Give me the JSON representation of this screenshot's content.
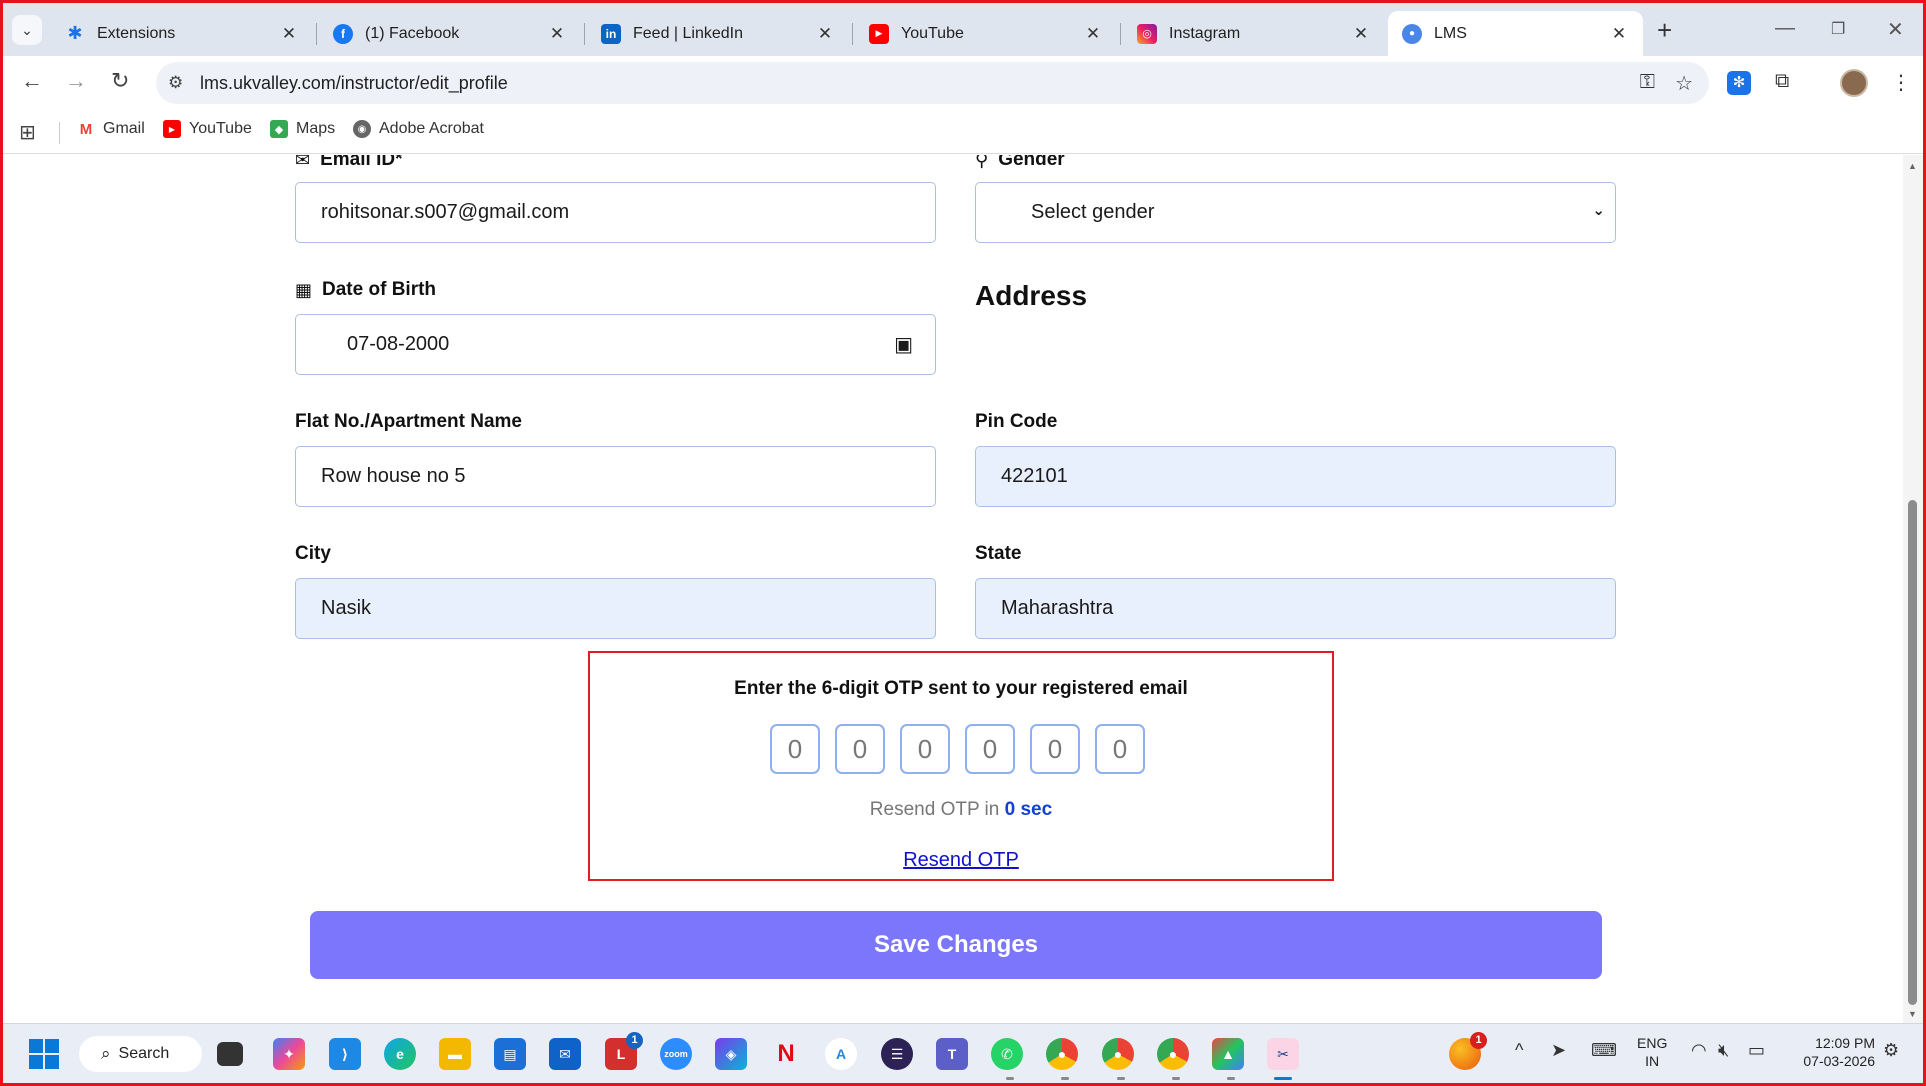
{
  "browser": {
    "tabs": [
      {
        "label": "Extensions",
        "icon": "puzzle-icon",
        "active": false
      },
      {
        "label": "(1) Facebook",
        "icon": "facebook-icon",
        "active": false
      },
      {
        "label": "Feed | LinkedIn",
        "icon": "linkedin-icon",
        "active": false
      },
      {
        "label": "YouTube",
        "icon": "youtube-icon",
        "active": false
      },
      {
        "label": "Instagram",
        "icon": "instagram-icon",
        "active": false
      },
      {
        "label": "LMS",
        "icon": "lms-icon",
        "active": true
      }
    ],
    "url": "lms.ukvalley.com/instructor/edit_profile",
    "bookmarks": [
      {
        "label": "Gmail",
        "icon": "gmail-icon"
      },
      {
        "label": "YouTube",
        "icon": "youtube-icon"
      },
      {
        "label": "Maps",
        "icon": "maps-icon"
      },
      {
        "label": "Adobe Acrobat",
        "icon": "acrobat-icon"
      }
    ]
  },
  "form": {
    "email_label": "Email ID*",
    "email_value": "rohitsonar.s007@gmail.com",
    "gender_label": "Gender",
    "gender_value": "Select gender",
    "dob_label": "Date of Birth",
    "dob_value": "07-08-2000",
    "address_title": "Address",
    "flat_label": "Flat No./Apartment Name",
    "flat_value": "Row house no 5",
    "pin_label": "Pin Code",
    "pin_value": "422101",
    "city_label": "City",
    "city_value": "Nasik",
    "state_label": "State",
    "state_value": "Maharashtra"
  },
  "otp": {
    "title": "Enter the 6-digit OTP sent to your registered email",
    "placeholders": [
      "0",
      "0",
      "0",
      "0",
      "0",
      "0"
    ],
    "resend_text": "Resend OTP in",
    "resend_seconds": "0 sec",
    "resend_link": "Resend OTP"
  },
  "save_button": "Save Changes",
  "taskbar": {
    "search_label": "Search",
    "outlook_badge": "1",
    "notification_badge": "1",
    "lang_line1": "ENG",
    "lang_line2": "IN",
    "time": "12:09 PM",
    "date": "07-03-2026"
  },
  "colors": {
    "accent_button": "#7b76fb",
    "otp_border": "#e31b23",
    "filled_field": "#e8f0fe",
    "link": "#1111cc"
  }
}
